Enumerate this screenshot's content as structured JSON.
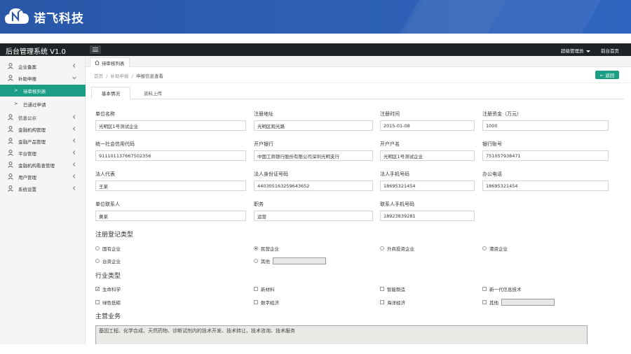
{
  "brand": {
    "name": "诺飞科技"
  },
  "topbar": {
    "system_title": "后台管理系统 V1.0",
    "admin_label": "超级管理员",
    "home_label": "前台首页"
  },
  "sidebar": {
    "items": [
      {
        "label": "企业备案"
      },
      {
        "label": "补助申报"
      },
      {
        "label": "信息公示"
      },
      {
        "label": "金融机构管理"
      },
      {
        "label": "金融产品管理"
      },
      {
        "label": "平台管理"
      },
      {
        "label": "金融机构看查管理"
      },
      {
        "label": "用户管理"
      },
      {
        "label": "系统设置"
      }
    ],
    "sub_items": [
      {
        "label": "待审核列表",
        "arrow": ">"
      },
      {
        "label": "已通过申请",
        "arrow": ">"
      }
    ]
  },
  "tabs": {
    "active": "待审核列表"
  },
  "breadcrumb": {
    "home": "首页",
    "level1": "补助申报",
    "current": "申报信息查看",
    "sep": "/"
  },
  "back_button": "← 返回",
  "inner_tabs": {
    "basic": "基本情况",
    "upload": "资料上传"
  },
  "form": {
    "unit_name": {
      "label": "单位名称",
      "value": "光明区1号测试企业"
    },
    "reg_address": {
      "label": "注册地址",
      "value": "光明区观光路"
    },
    "reg_time": {
      "label": "注册时间",
      "value": "2015-01-08"
    },
    "reg_capital": {
      "label": "注册资金（万元）",
      "value": "1000"
    },
    "credit_code": {
      "label": "统一社会信用代码",
      "value": "911101137667502356"
    },
    "bank": {
      "label": "开户银行",
      "value": "中国工商银行股份有限公司深圳光明支行"
    },
    "account_name": {
      "label": "开户户名",
      "value": "光明区1号测试企业"
    },
    "bank_account": {
      "label": "银行账号",
      "value": "751057938471"
    },
    "legal_rep": {
      "label": "法人代表",
      "value": "王某"
    },
    "legal_id": {
      "label": "法人身份证号码",
      "value": "440305163259643652"
    },
    "legal_phone": {
      "label": "法人手机号码",
      "value": "18695321454"
    },
    "office_phone": {
      "label": "办公电话",
      "value": "18695321454"
    },
    "contact": {
      "label": "单位联系人",
      "value": "黄某"
    },
    "position": {
      "label": "职务",
      "value": "运营"
    },
    "contact_phone": {
      "label": "联系人手机号码",
      "value": "18923839281"
    }
  },
  "reg_type": {
    "title": "注册登记类型",
    "options": [
      {
        "label": "国有企业",
        "checked": false
      },
      {
        "label": "民营企业",
        "checked": true
      },
      {
        "label": "外商投资企业",
        "checked": false
      },
      {
        "label": "港资企业",
        "checked": false
      },
      {
        "label": "台资企业",
        "checked": false
      },
      {
        "label": "其他",
        "checked": false
      }
    ]
  },
  "industry": {
    "title": "行业类型",
    "options": [
      {
        "label": "生命科学",
        "checked": true
      },
      {
        "label": "新材料",
        "checked": false
      },
      {
        "label": "智能制造",
        "checked": false
      },
      {
        "label": "新一代信息技术",
        "checked": false
      },
      {
        "label": "绿色低碳",
        "checked": false
      },
      {
        "label": "数字经济",
        "checked": false
      },
      {
        "label": "海洋经济",
        "checked": false
      },
      {
        "label": "其他",
        "checked": false
      }
    ]
  },
  "main_business": {
    "title": "主营业务",
    "value": "基因工程、化学合成、天然药物、诊断试剂内的技术开发、技术转让、技术咨询、技术服务"
  }
}
